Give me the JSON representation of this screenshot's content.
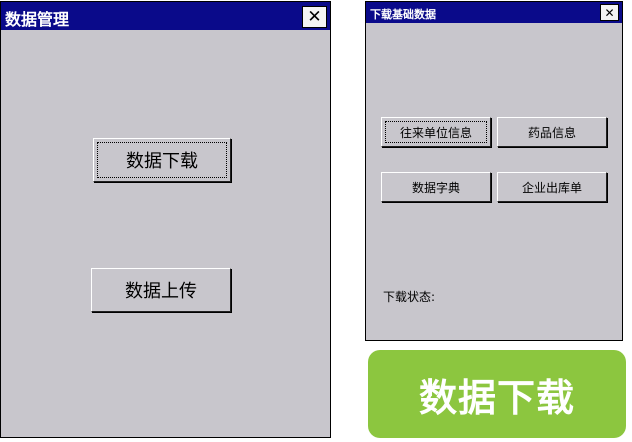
{
  "left_window": {
    "title": "数据管理",
    "close_glyph": "✕",
    "buttons": {
      "download": "数据下载",
      "upload": "数据上传"
    }
  },
  "right_window": {
    "title": "下载基础数据",
    "close_glyph": "✕",
    "buttons": {
      "partner_info": "往来单位信息",
      "drug_info": "药品信息",
      "data_dictionary": "数据字典",
      "outbound_order": "企业出库单"
    },
    "status_label": "下载状态:"
  },
  "badge": {
    "text": "数据下载"
  },
  "colors": {
    "titlebar": "#0a0a8a",
    "window_bg": "#c8c6cc",
    "badge_bg": "#8cc63f"
  }
}
